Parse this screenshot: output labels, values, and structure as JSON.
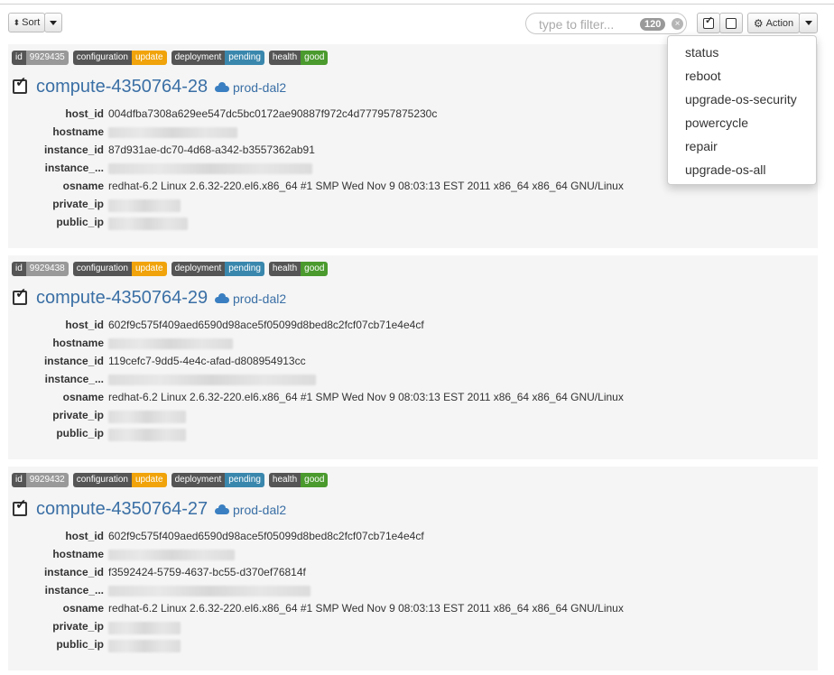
{
  "toolbar": {
    "sort_label": "Sort",
    "filter_placeholder": "type to filter...",
    "filter_count": "120",
    "action_label": "Action"
  },
  "action_menu": [
    "status",
    "reboot",
    "upgrade-os-security",
    "powercycle",
    "repair",
    "upgrade-os-all"
  ],
  "hosts": [
    {
      "id": "9929435",
      "configuration": "update",
      "deployment": "pending",
      "health": "good",
      "name": "compute-4350764-28",
      "region": "prod-dal2",
      "host_id": "004dfba7308a629ee547dc5bc0172ae90887f972c4d777957875230c",
      "instance_id": "87d931ae-dc70-4d68-a342-b3557362ab91",
      "osname": "redhat-6.2 Linux 2.6.32-220.el6.x86_64 #1 SMP Wed Nov 9 08:03:13 EST 2011 x86_64 x86_64 GNU/Linux"
    },
    {
      "id": "9929438",
      "configuration": "update",
      "deployment": "pending",
      "health": "good",
      "name": "compute-4350764-29",
      "region": "prod-dal2",
      "host_id": "602f9c575f409aed6590d98ace5f05099d8bed8c2fcf07cb71e4e4cf",
      "instance_id": "119cefc7-9dd5-4e4c-afad-d808954913cc",
      "osname": "redhat-6.2 Linux 2.6.32-220.el6.x86_64 #1 SMP Wed Nov 9 08:03:13 EST 2011 x86_64 x86_64 GNU/Linux"
    },
    {
      "id": "9929432",
      "configuration": "update",
      "deployment": "pending",
      "health": "good",
      "name": "compute-4350764-27",
      "region": "prod-dal2",
      "host_id": "602f9c575f409aed6590d98ace5f05099d8bed8c2fcf07cb71e4e4cf",
      "instance_id": "f3592424-5759-4637-bc55-d370ef76814f",
      "osname": "redhat-6.2 Linux 2.6.32-220.el6.x86_64 #1 SMP Wed Nov 9 08:03:13 EST 2011 x86_64 x86_64 GNU/Linux"
    }
  ],
  "labels": {
    "id": "id",
    "configuration": "configuration",
    "deployment": "deployment",
    "health": "health",
    "host_id": "host_id",
    "hostname": "hostname",
    "instance_id": "instance_id",
    "instance_trunc": "instance_...",
    "osname": "osname",
    "private_ip": "private_ip",
    "public_ip": "public_ip"
  }
}
